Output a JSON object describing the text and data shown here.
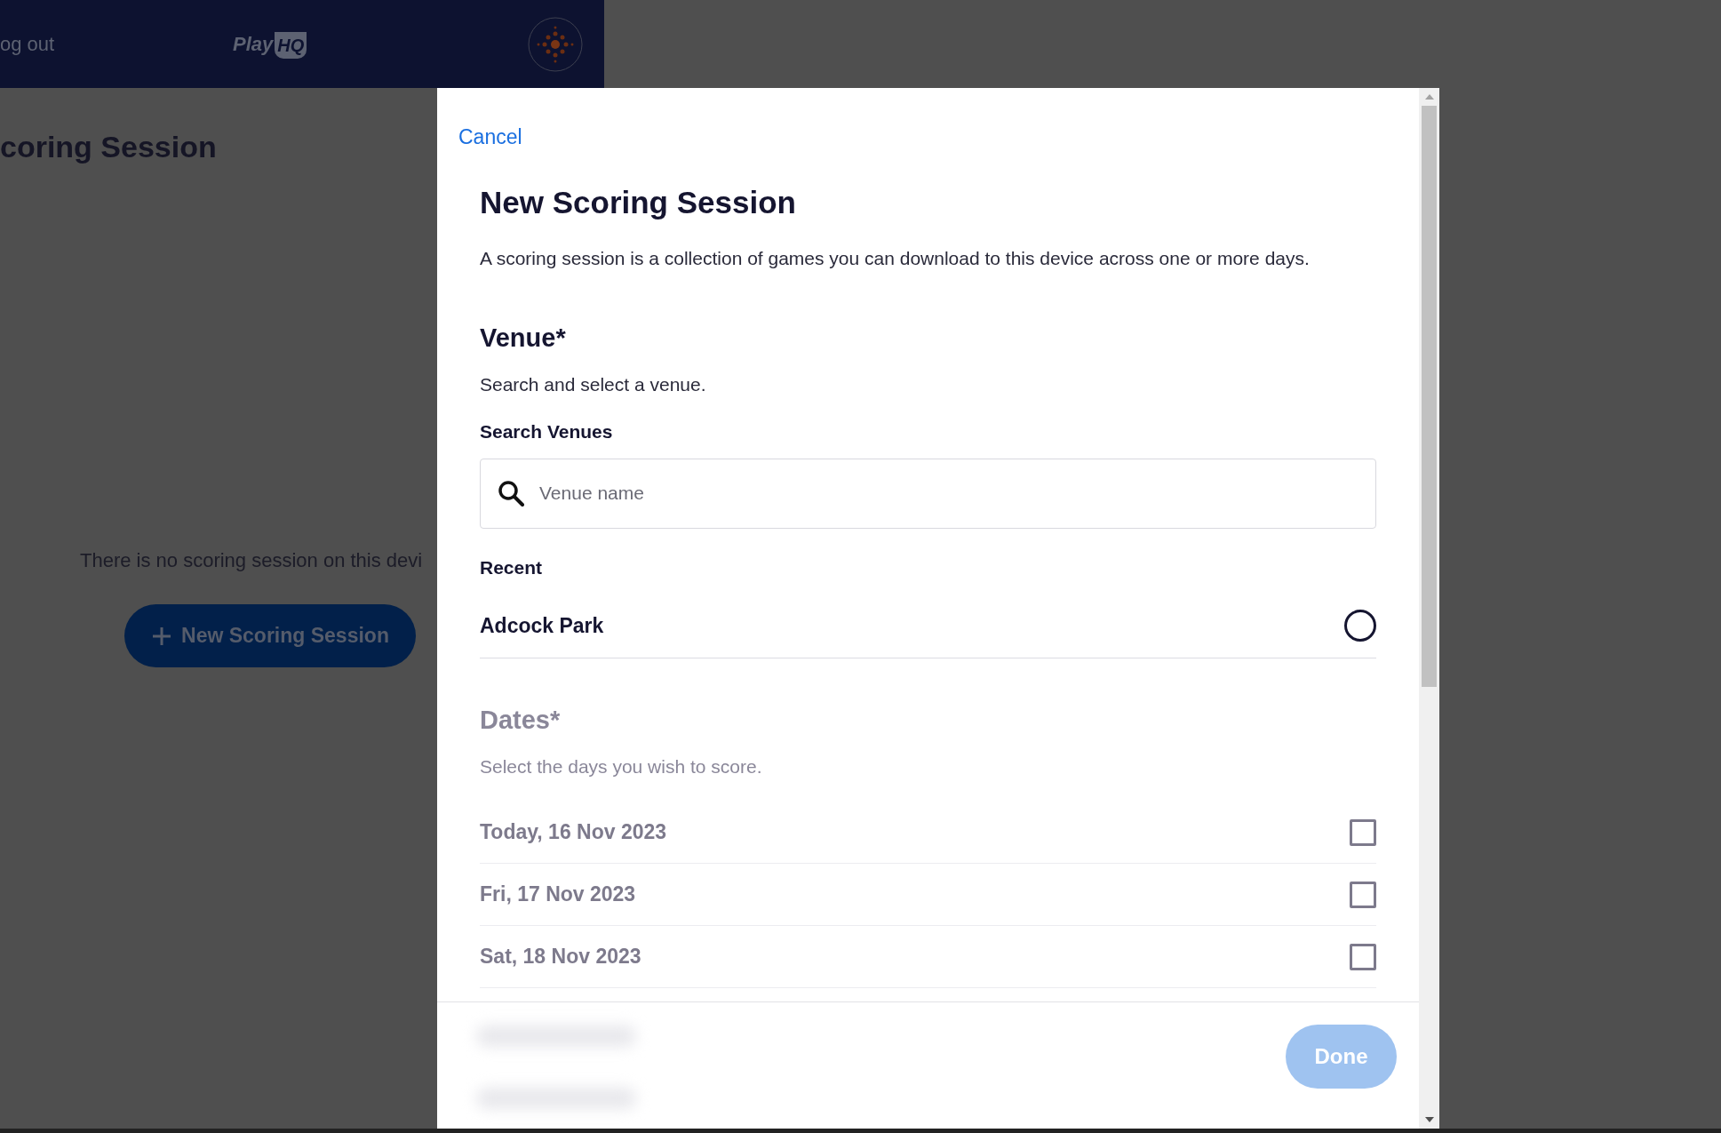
{
  "background": {
    "header": {
      "logout": "og out",
      "logo": {
        "play": "Play",
        "hq": "HQ"
      }
    },
    "page_title": "coring Session",
    "empty_message": "There is no scoring session on this devi",
    "new_button": "New Scoring Session"
  },
  "modal": {
    "cancel": "Cancel",
    "title": "New Scoring Session",
    "description": "A scoring session is a collection of games you can download to this device across one or more days.",
    "venue": {
      "heading": "Venue*",
      "hint": "Search and select a venue.",
      "search_label": "Search Venues",
      "search": {
        "placeholder": "Venue name"
      },
      "recent_label": "Recent",
      "recent": [
        {
          "name": "Adcock Park",
          "selected": false
        }
      ]
    },
    "dates": {
      "disabled": true,
      "heading": "Dates*",
      "hint": "Select the days you wish to score.",
      "days": [
        {
          "label": "Today, 16 Nov 2023",
          "checked": false
        },
        {
          "label": "Fri, 17 Nov 2023",
          "checked": false
        },
        {
          "label": "Sat, 18 Nov 2023",
          "checked": false
        }
      ]
    },
    "done": {
      "label": "Done",
      "disabled": true
    }
  }
}
